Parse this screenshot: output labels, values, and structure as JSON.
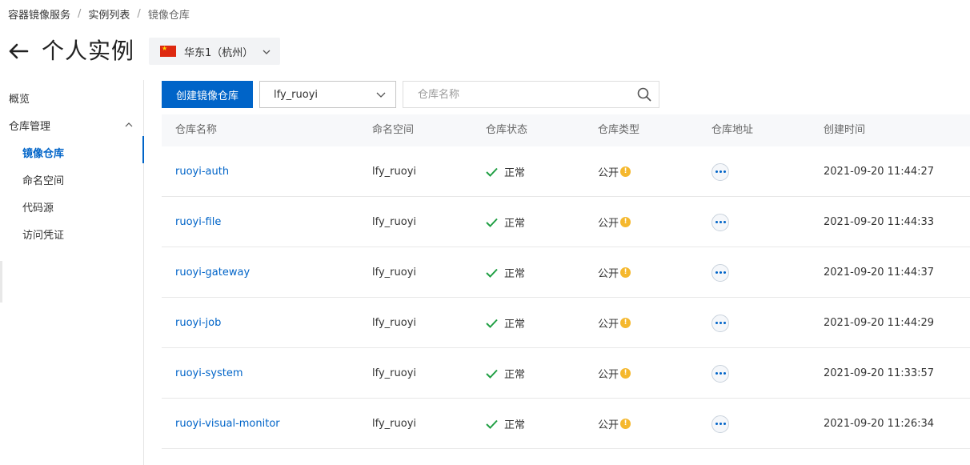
{
  "breadcrumb": {
    "items": [
      "容器镜像服务",
      "实例列表",
      "镜像仓库"
    ],
    "separator": "/"
  },
  "header": {
    "title": "个人实例",
    "back_icon": "arrow-left-icon",
    "region": {
      "label": "华东1（杭州）",
      "flag_icon": "china-flag-icon"
    }
  },
  "sidebar": {
    "overview": "概览",
    "repo_management": "仓库管理",
    "items": [
      "镜像仓库",
      "命名空间",
      "代码源",
      "访问凭证"
    ],
    "active_item": "镜像仓库"
  },
  "toolbar": {
    "create_label": "创建镜像仓库",
    "namespace_value": "lfy_ruoyi",
    "search_placeholder": "仓库名称"
  },
  "table": {
    "columns": [
      "仓库名称",
      "命名空间",
      "仓库状态",
      "仓库类型",
      "仓库地址",
      "创建时间"
    ],
    "rows": [
      {
        "name": "ruoyi-auth",
        "namespace": "lfy_ruoyi",
        "status": "正常",
        "type": "公开",
        "created": "2021-09-20 11:44:27"
      },
      {
        "name": "ruoyi-file",
        "namespace": "lfy_ruoyi",
        "status": "正常",
        "type": "公开",
        "created": "2021-09-20 11:44:33"
      },
      {
        "name": "ruoyi-gateway",
        "namespace": "lfy_ruoyi",
        "status": "正常",
        "type": "公开",
        "created": "2021-09-20 11:44:37"
      },
      {
        "name": "ruoyi-job",
        "namespace": "lfy_ruoyi",
        "status": "正常",
        "type": "公开",
        "created": "2021-09-20 11:44:29"
      },
      {
        "name": "ruoyi-system",
        "namespace": "lfy_ruoyi",
        "status": "正常",
        "type": "公开",
        "created": "2021-09-20 11:33:57"
      },
      {
        "name": "ruoyi-visual-monitor",
        "namespace": "lfy_ruoyi",
        "status": "正常",
        "type": "公开",
        "created": "2021-09-20 11:26:34"
      }
    ]
  },
  "colors": {
    "primary": "#0064c8",
    "success": "#1e9e42",
    "warning": "#f5b82e"
  }
}
